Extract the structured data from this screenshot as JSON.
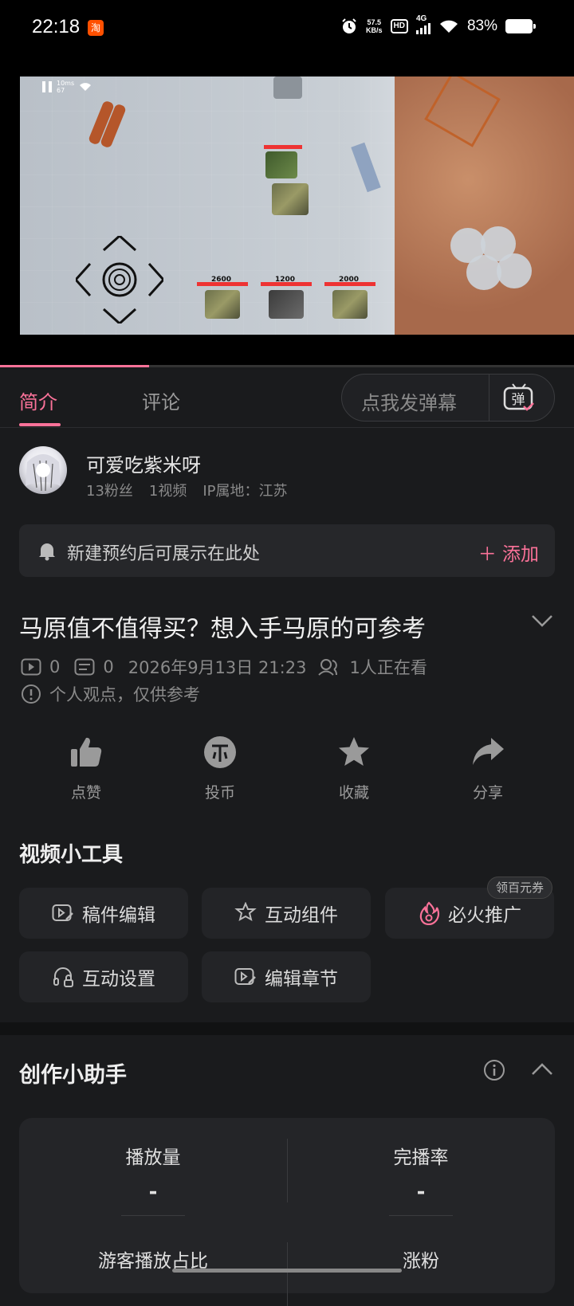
{
  "status_bar": {
    "time": "22:18",
    "app_badge": "淘",
    "net_speed_value": "57.5",
    "net_speed_unit": "KB/s",
    "hd": "HD",
    "signal": "4G",
    "battery": "83%"
  },
  "video": {
    "hud_latency": "10ms",
    "hud_fps": "67",
    "hp_values": [
      "2600",
      "1200",
      "2000"
    ],
    "progress_fraction": 0.26
  },
  "tabs": {
    "intro": "简介",
    "comments": "评论",
    "danmaku_placeholder": "点我发弹幕",
    "danmaku_button": "弹"
  },
  "author": {
    "name": "可爱吃紫米呀",
    "fans": "13粉丝",
    "videos": "1视频",
    "ip": "IP属地：江苏"
  },
  "reserve": {
    "text": "新建预约后可展示在此处",
    "add": "＋ 添加"
  },
  "video_info": {
    "title": "马原值不值得买？想入手马原的可参考",
    "plays": "0",
    "danmaku_count": "0",
    "date": "2026年9月13日 21:23",
    "watching": "1人正在看",
    "note": "个人观点，仅供参考"
  },
  "actions": {
    "like": "点赞",
    "coin": "投币",
    "favorite": "收藏",
    "share": "分享"
  },
  "tools": {
    "title": "视频小工具",
    "items": [
      "稿件编辑",
      "互动组件",
      "必火推广",
      "互动设置",
      "编辑章节"
    ],
    "badge": "领百元券"
  },
  "helper": {
    "title": "创作小助手",
    "metrics": [
      {
        "label": "播放量",
        "value": "-"
      },
      {
        "label": "完播率",
        "value": "-"
      },
      {
        "label": "游客播放占比",
        "value": ""
      },
      {
        "label": "涨粉",
        "value": ""
      }
    ]
  },
  "colors": {
    "accent": "#fb7299",
    "background": "#1a1b1d",
    "card": "#232427"
  }
}
